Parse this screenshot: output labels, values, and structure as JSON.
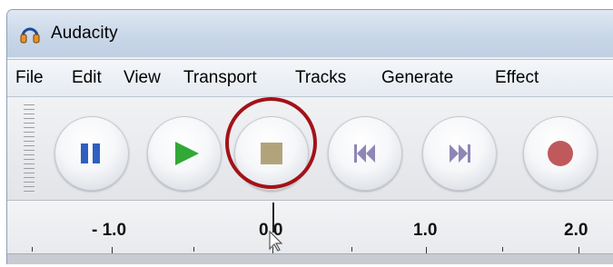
{
  "window": {
    "title": "Audacity"
  },
  "menu": [
    "File",
    "Edit",
    "View",
    "Transport",
    "Tracks",
    "Generate",
    "Effect"
  ],
  "toolbar": {
    "buttons": [
      "pause-button",
      "play-button",
      "stop-button",
      "skip-to-start-button",
      "skip-to-end-button",
      "record-button"
    ]
  },
  "ruler": {
    "labels": [
      "- 1.0",
      "0.0",
      "1.0",
      "2.0"
    ]
  },
  "colors": {
    "accent_highlight": "#a31218",
    "pause": "#2f5fbf",
    "play": "#32a836",
    "stop": "#b2a47a",
    "skip": "#8f86b6",
    "record": "#c0595c"
  }
}
